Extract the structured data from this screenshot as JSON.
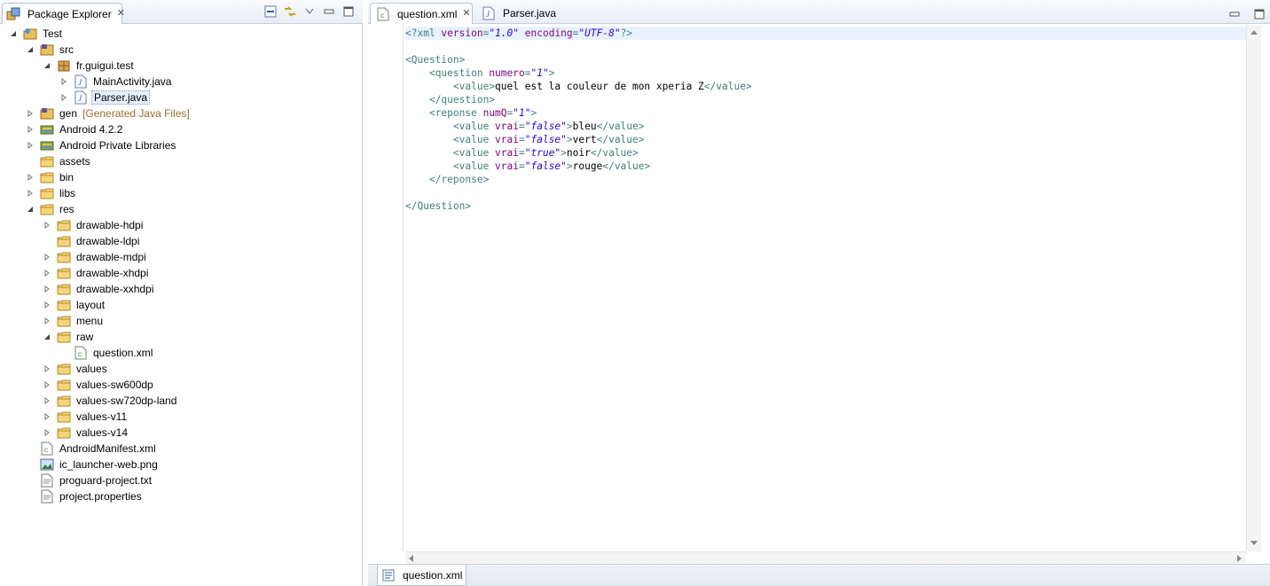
{
  "left_panel": {
    "tab_label": "Package Explorer",
    "tree": [
      {
        "label": "Test",
        "level": 0,
        "twisty": "open",
        "icon": "project"
      },
      {
        "label": "src",
        "level": 1,
        "twisty": "open",
        "icon": "source-folder"
      },
      {
        "label": "fr.guigui.test",
        "level": 2,
        "twisty": "open",
        "icon": "package"
      },
      {
        "label": "MainActivity.java",
        "level": 3,
        "twisty": "closed",
        "icon": "java-file"
      },
      {
        "label": "Parser.java",
        "level": 3,
        "twisty": "closed",
        "icon": "java-file",
        "selected": true
      },
      {
        "label": "gen",
        "level": 1,
        "twisty": "closed",
        "icon": "source-folder",
        "decoration": "[Generated Java Files]"
      },
      {
        "label": "Android 4.2.2",
        "level": 1,
        "twisty": "closed",
        "icon": "library"
      },
      {
        "label": "Android Private Libraries",
        "level": 1,
        "twisty": "closed",
        "icon": "library"
      },
      {
        "label": "assets",
        "level": 1,
        "twisty": "none",
        "icon": "folder"
      },
      {
        "label": "bin",
        "level": 1,
        "twisty": "closed",
        "icon": "folder"
      },
      {
        "label": "libs",
        "level": 1,
        "twisty": "closed",
        "icon": "folder"
      },
      {
        "label": "res",
        "level": 1,
        "twisty": "open",
        "icon": "folder"
      },
      {
        "label": "drawable-hdpi",
        "level": 2,
        "twisty": "closed",
        "icon": "folder"
      },
      {
        "label": "drawable-ldpi",
        "level": 2,
        "twisty": "none",
        "icon": "folder"
      },
      {
        "label": "drawable-mdpi",
        "level": 2,
        "twisty": "closed",
        "icon": "folder"
      },
      {
        "label": "drawable-xhdpi",
        "level": 2,
        "twisty": "closed",
        "icon": "folder"
      },
      {
        "label": "drawable-xxhdpi",
        "level": 2,
        "twisty": "closed",
        "icon": "folder"
      },
      {
        "label": "layout",
        "level": 2,
        "twisty": "closed",
        "icon": "folder"
      },
      {
        "label": "menu",
        "level": 2,
        "twisty": "closed",
        "icon": "folder"
      },
      {
        "label": "raw",
        "level": 2,
        "twisty": "open",
        "icon": "folder"
      },
      {
        "label": "question.xml",
        "level": 3,
        "twisty": "none",
        "icon": "xml-file"
      },
      {
        "label": "values",
        "level": 2,
        "twisty": "closed",
        "icon": "folder"
      },
      {
        "label": "values-sw600dp",
        "level": 2,
        "twisty": "closed",
        "icon": "folder"
      },
      {
        "label": "values-sw720dp-land",
        "level": 2,
        "twisty": "closed",
        "icon": "folder"
      },
      {
        "label": "values-v11",
        "level": 2,
        "twisty": "closed",
        "icon": "folder"
      },
      {
        "label": "values-v14",
        "level": 2,
        "twisty": "closed",
        "icon": "folder"
      },
      {
        "label": "AndroidManifest.xml",
        "level": 1,
        "twisty": "none",
        "icon": "xml-file"
      },
      {
        "label": "ic_launcher-web.png",
        "level": 1,
        "twisty": "none",
        "icon": "image-file"
      },
      {
        "label": "proguard-project.txt",
        "level": 1,
        "twisty": "none",
        "icon": "text-file"
      },
      {
        "label": "project.properties",
        "level": 1,
        "twisty": "none",
        "icon": "text-file"
      }
    ]
  },
  "editor": {
    "tabs": [
      {
        "label": "question.xml",
        "icon": "xml-file",
        "active": true
      },
      {
        "label": "Parser.java",
        "icon": "java-file",
        "active": false
      }
    ],
    "bottom_tab_label": "question.xml",
    "code_lines": [
      [
        [
          "pi",
          "<?xml "
        ],
        [
          "attr",
          "version"
        ],
        [
          "pi",
          "="
        ],
        [
          "val",
          "\"1.0\""
        ],
        [
          "pi",
          " "
        ],
        [
          "attr",
          "encoding"
        ],
        [
          "pi",
          "="
        ],
        [
          "val",
          "\"UTF-8\""
        ],
        [
          "pi",
          "?>"
        ]
      ],
      [],
      [
        [
          "tag",
          "<Question>"
        ]
      ],
      [
        [
          "txt",
          "    "
        ],
        [
          "tag",
          "<question "
        ],
        [
          "attr",
          "numero"
        ],
        [
          "tag",
          "="
        ],
        [
          "val",
          "\"1\""
        ],
        [
          "tag",
          ">"
        ]
      ],
      [
        [
          "txt",
          "        "
        ],
        [
          "tag",
          "<value>"
        ],
        [
          "txt",
          "quel est la couleur de mon xperia Z"
        ],
        [
          "tag",
          "</value>"
        ]
      ],
      [
        [
          "txt",
          "    "
        ],
        [
          "tag",
          "</question>"
        ]
      ],
      [
        [
          "txt",
          "    "
        ],
        [
          "tag",
          "<reponse "
        ],
        [
          "attr",
          "numQ"
        ],
        [
          "tag",
          "="
        ],
        [
          "val",
          "\"1\""
        ],
        [
          "tag",
          ">"
        ]
      ],
      [
        [
          "txt",
          "        "
        ],
        [
          "tag",
          "<value "
        ],
        [
          "attr",
          "vrai"
        ],
        [
          "tag",
          "="
        ],
        [
          "val",
          "\"false\""
        ],
        [
          "tag",
          ">"
        ],
        [
          "txt",
          "bleu"
        ],
        [
          "tag",
          "</value>"
        ]
      ],
      [
        [
          "txt",
          "        "
        ],
        [
          "tag",
          "<value "
        ],
        [
          "attr",
          "vrai"
        ],
        [
          "tag",
          "="
        ],
        [
          "val",
          "\"false\""
        ],
        [
          "tag",
          ">"
        ],
        [
          "txt",
          "vert"
        ],
        [
          "tag",
          "</value>"
        ]
      ],
      [
        [
          "txt",
          "        "
        ],
        [
          "tag",
          "<value "
        ],
        [
          "attr",
          "vrai"
        ],
        [
          "tag",
          "="
        ],
        [
          "val",
          "\"true\""
        ],
        [
          "tag",
          ">"
        ],
        [
          "txt",
          "noir"
        ],
        [
          "tag",
          "</value>"
        ]
      ],
      [
        [
          "txt",
          "        "
        ],
        [
          "tag",
          "<value "
        ],
        [
          "attr",
          "vrai"
        ],
        [
          "tag",
          "="
        ],
        [
          "val",
          "\"false\""
        ],
        [
          "tag",
          ">"
        ],
        [
          "txt",
          "rouge"
        ],
        [
          "tag",
          "</value>"
        ]
      ],
      [
        [
          "txt",
          "    "
        ],
        [
          "tag",
          "</reponse>"
        ]
      ],
      [],
      [
        [
          "tag",
          "</Question>"
        ]
      ]
    ]
  },
  "colors": {
    "xml_tag": "#3f7f7f",
    "xml_attr": "#7f007f",
    "xml_value": "#2a00ff",
    "current_line": "#e8f2fe",
    "selection": "#e5f0fb"
  }
}
